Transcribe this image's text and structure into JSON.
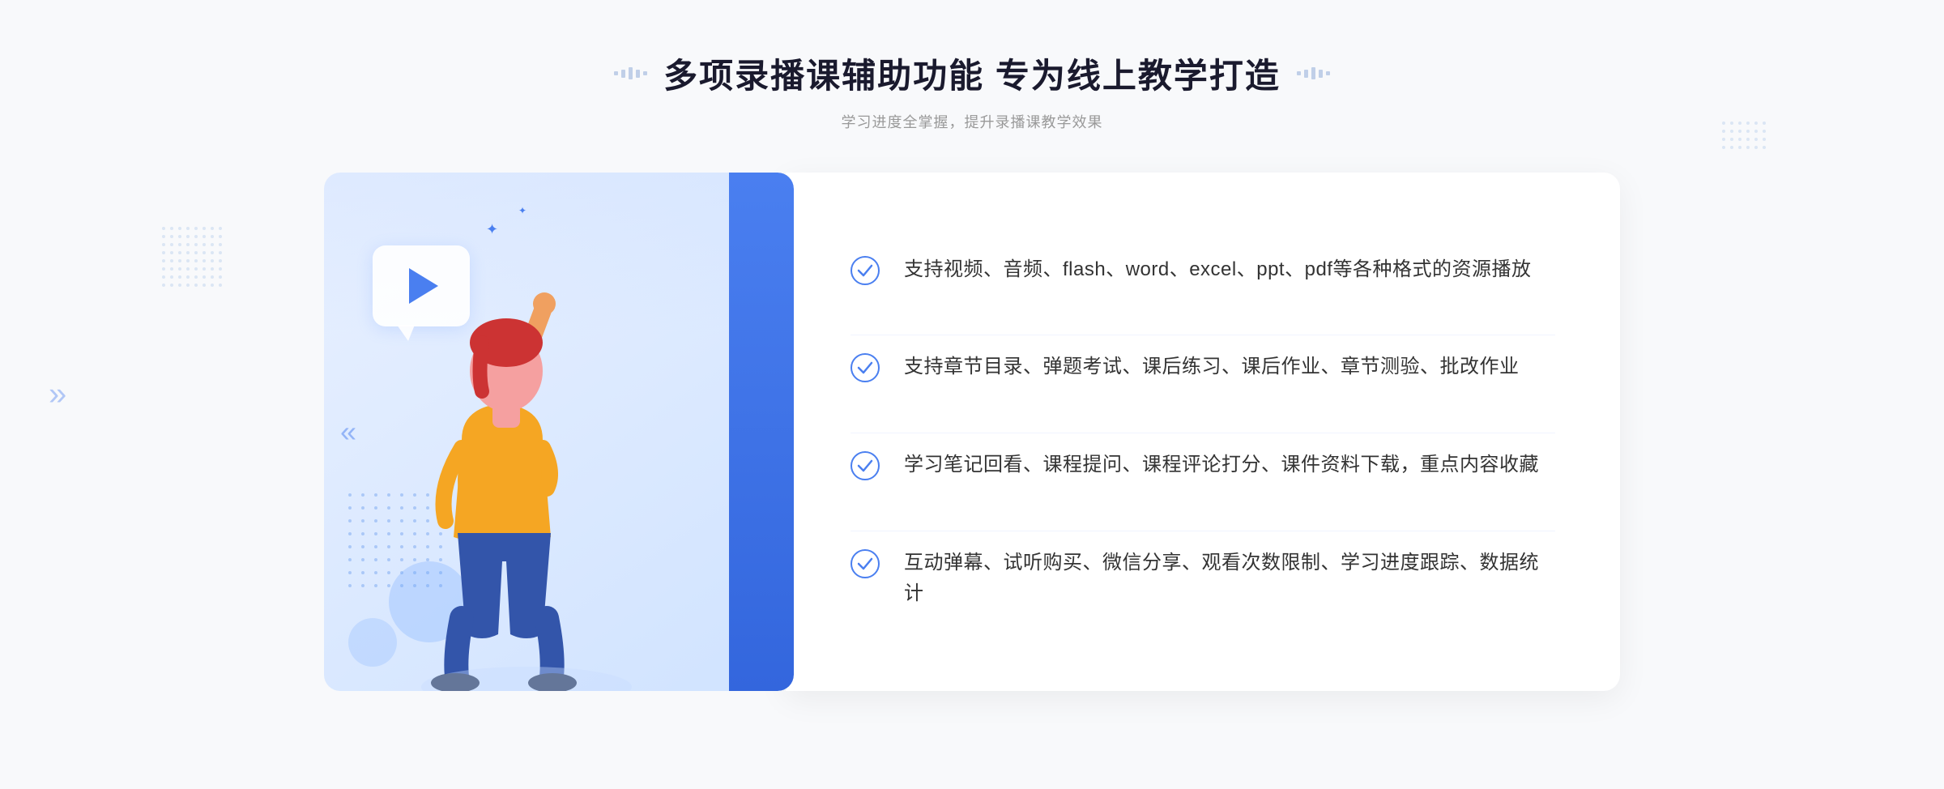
{
  "header": {
    "title": "多项录播课辅助功能 专为线上教学打造",
    "subtitle": "学习进度全掌握，提升录播课教学效果"
  },
  "features": [
    {
      "id": "feature-1",
      "text": "支持视频、音频、flash、word、excel、ppt、pdf等各种格式的资源播放"
    },
    {
      "id": "feature-2",
      "text": "支持章节目录、弹题考试、课后练习、课后作业、章节测验、批改作业"
    },
    {
      "id": "feature-3",
      "text": "学习笔记回看、课程提问、课程评论打分、课件资料下载，重点内容收藏"
    },
    {
      "id": "feature-4",
      "text": "互动弹幕、试听购买、微信分享、观看次数限制、学习进度跟踪、数据统计"
    }
  ],
  "decorations": {
    "chevron_left": "《",
    "play_label": "play-button"
  }
}
